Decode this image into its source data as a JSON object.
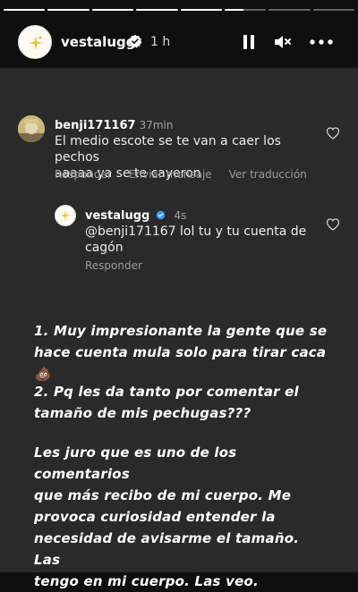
{
  "story": {
    "segments": [
      1,
      1,
      1,
      1,
      1,
      0.45,
      0,
      0
    ],
    "header": {
      "username": "vestalugg",
      "time_ago": "1 h"
    },
    "comment": {
      "username": "benji171167",
      "time": "37min",
      "text_line1": "El medio escote se te van a caer los pechos",
      "text_line2": "aaaaa ya se te cayeron",
      "actions": [
        "Responder",
        "Enviar mensaje",
        "Ver traducción"
      ]
    },
    "reply": {
      "username": "vestalugg",
      "time": "4s",
      "text_line1": "@benji171167 lol tu y tu cuenta de",
      "text_line2": "cagón",
      "action": "Responder"
    },
    "message": {
      "lines1": [
        "1. Muy impresionante la gente que se",
        "hace cuenta mula solo para tirar caca 💩"
      ],
      "lines2": [
        "2. Pq les da tanto por comentar el",
        "tamaño de mis pechugas???"
      ],
      "lines3": [
        "Les juro que es uno de los comentarios",
        "que más recibo de mi cuerpo. Me",
        "provoca curiosidad entender la",
        "necesidad de avisarme el tamaño. Las",
        "tengo en mi cuerpo. Las veo."
      ]
    }
  }
}
